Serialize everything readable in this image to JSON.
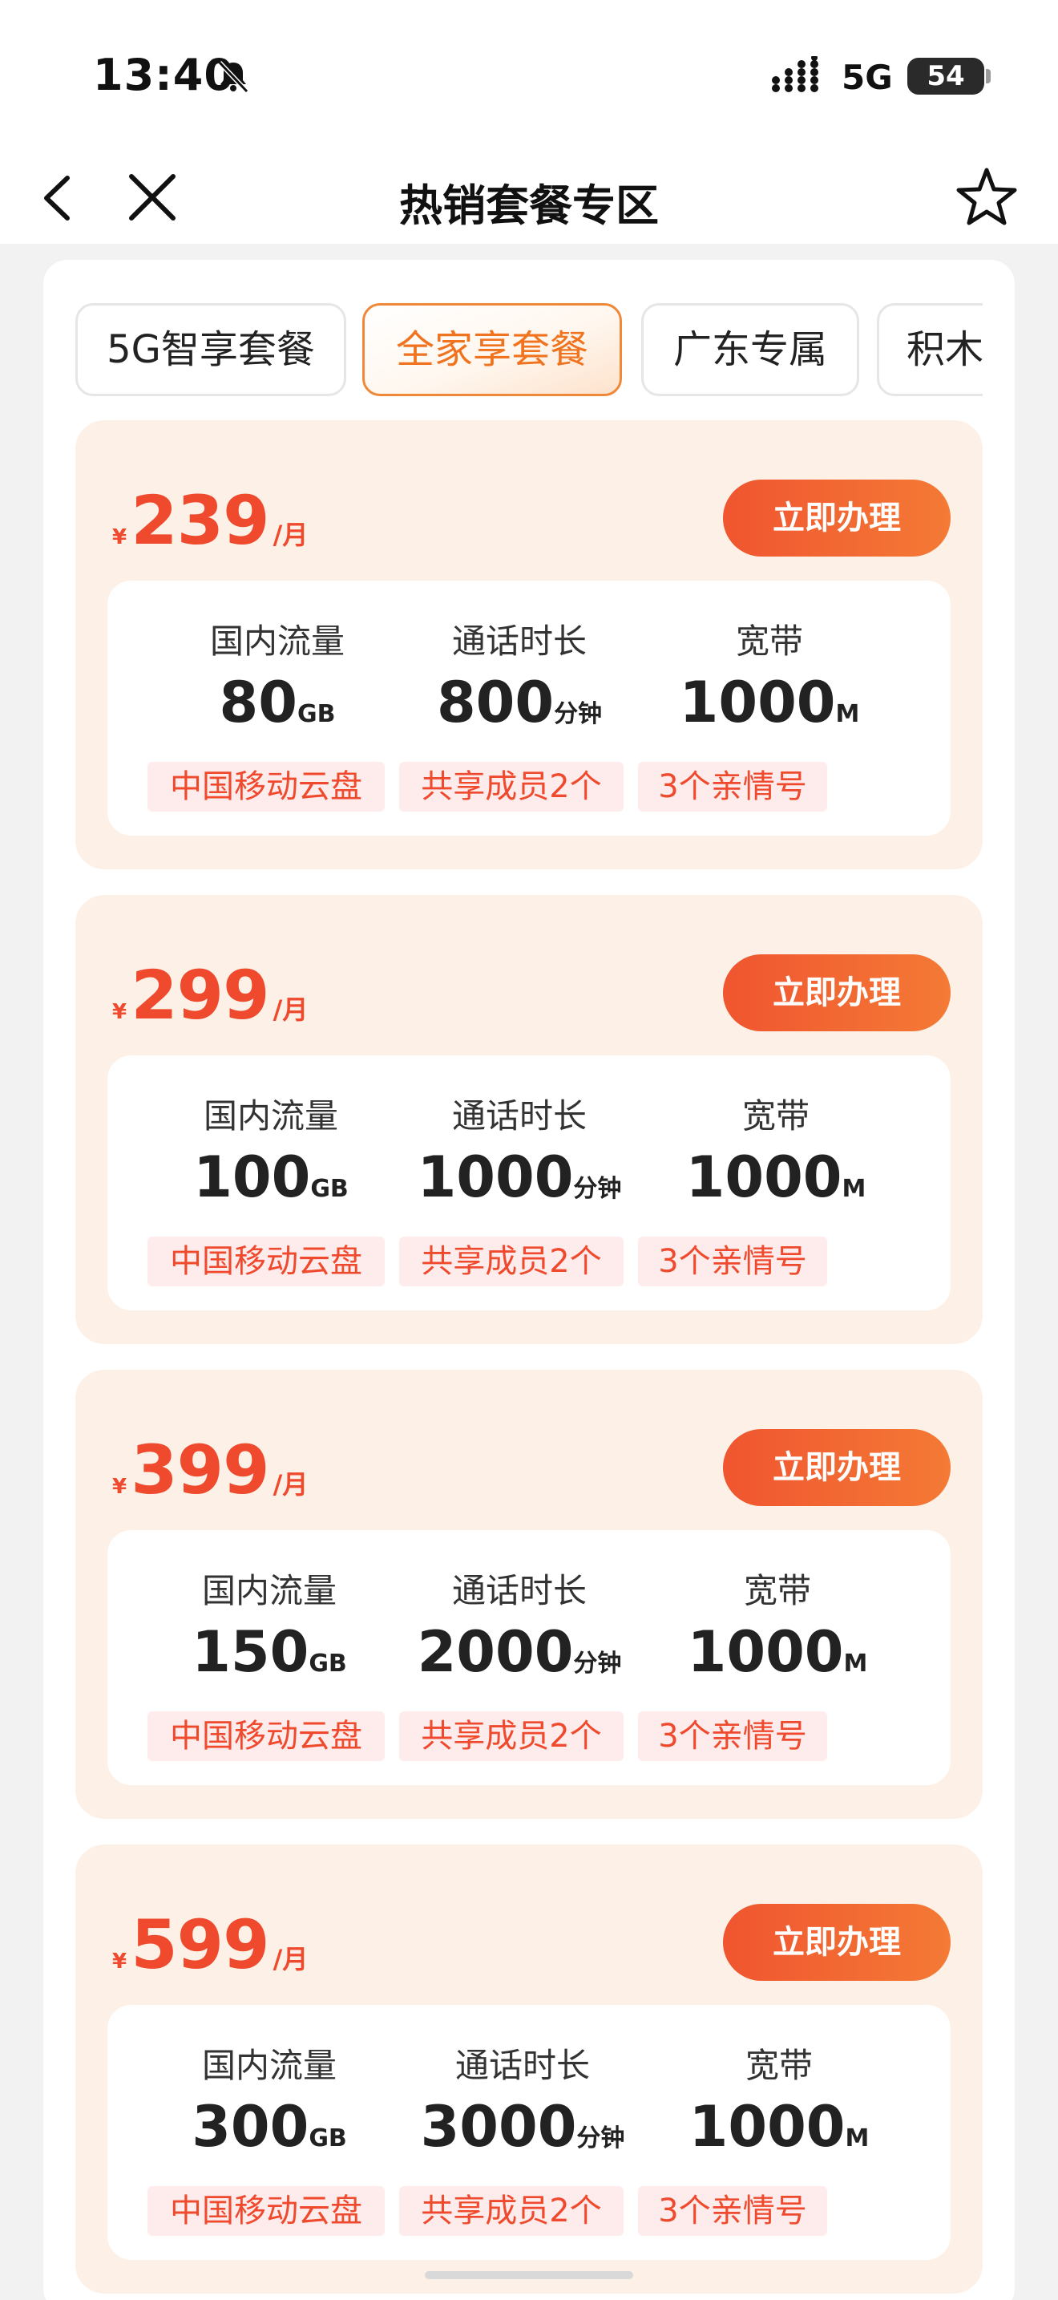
{
  "status": {
    "time": "13:40",
    "network": "5G",
    "battery": "54"
  },
  "nav": {
    "title": "热销套餐专区"
  },
  "tabs": [
    {
      "label": "5G智享套餐",
      "active": false
    },
    {
      "label": "全家享套餐",
      "active": true
    },
    {
      "label": "广东专属",
      "active": false
    },
    {
      "label": "积木",
      "active": false
    }
  ],
  "labels": {
    "currency": "¥",
    "per_month": "/月",
    "buy": "立即办理",
    "data": "国内流量",
    "voice": "通话时长",
    "broadband": "宽带",
    "data_unit": "GB",
    "voice_unit": "分钟",
    "broadband_unit": "M"
  },
  "plans": [
    {
      "price": "239",
      "data": "80",
      "voice": "800",
      "broadband": "1000",
      "tags": [
        "中国移动云盘",
        "共享成员2个",
        "3个亲情号"
      ]
    },
    {
      "price": "299",
      "data": "100",
      "voice": "1000",
      "broadband": "1000",
      "tags": [
        "中国移动云盘",
        "共享成员2个",
        "3个亲情号"
      ]
    },
    {
      "price": "399",
      "data": "150",
      "voice": "2000",
      "broadband": "1000",
      "tags": [
        "中国移动云盘",
        "共享成员2个",
        "3个亲情号"
      ]
    },
    {
      "price": "599",
      "data": "300",
      "voice": "3000",
      "broadband": "1000",
      "tags": [
        "中国移动云盘",
        "共享成员2个",
        "3个亲情号"
      ]
    }
  ],
  "colors": {
    "accent": "#ef4a2e",
    "tab_active": "#f0731f",
    "card_bg": "#fdf1e7",
    "tag_bg": "#fdeceb"
  }
}
